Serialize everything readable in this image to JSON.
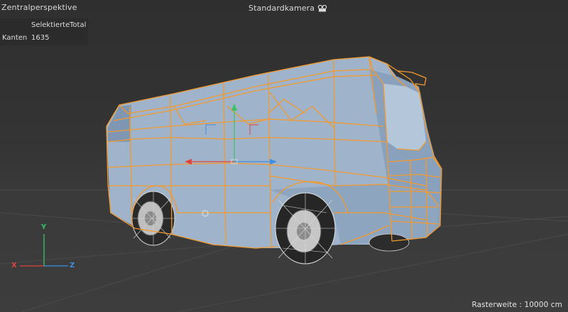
{
  "viewport": {
    "title": "Zentralperspektive",
    "camera_label": "Standardkamera",
    "camera_icon": "camera-icon",
    "grid_label": "Rasterweite : 10000 cm"
  },
  "stats": {
    "col_selected": "Selektierte",
    "col_total": "Total",
    "row_label": "Kanten",
    "selected_value": "1635"
  },
  "axis": {
    "x": "X",
    "y": "Y",
    "z": "Z"
  },
  "colors": {
    "wireframe": "#f39a2e",
    "bus_surface": "#9eb4cd",
    "axis_x": "#e0443c",
    "axis_y": "#37c468",
    "axis_z": "#3d8fe0"
  }
}
